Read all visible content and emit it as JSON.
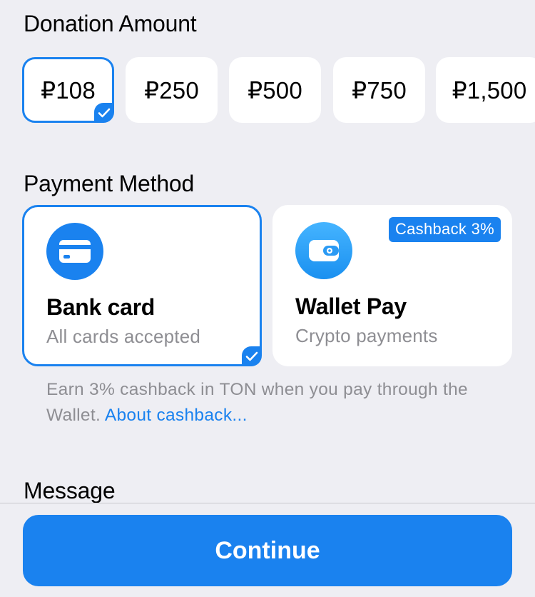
{
  "donation": {
    "title": "Donation Amount",
    "amounts": [
      "₽108",
      "₽250",
      "₽500",
      "₽750",
      "₽1,500"
    ],
    "selected_index": 0
  },
  "payment": {
    "title": "Payment Method",
    "methods": [
      {
        "title": "Bank card",
        "subtitle": "All cards accepted",
        "icon": "credit-card-icon",
        "selected": true
      },
      {
        "title": "Wallet Pay",
        "subtitle": "Crypto payments",
        "icon": "wallet-icon",
        "badge": "Cashback 3%",
        "selected": false
      }
    ],
    "note_text": "Earn 3% cashback in TON when you pay through the Wallet. ",
    "note_link": "About cashback..."
  },
  "message": {
    "title": "Message"
  },
  "actions": {
    "continue_label": "Continue"
  },
  "colors": {
    "accent": "#1a82ef",
    "background": "#eeeef3",
    "card": "#ffffff",
    "secondary_text": "#8e8e93"
  }
}
